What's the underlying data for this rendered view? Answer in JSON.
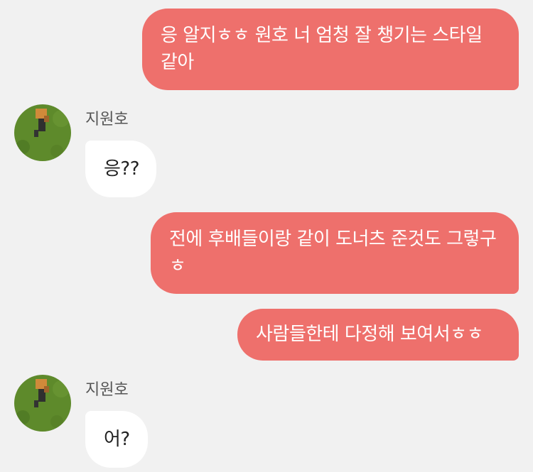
{
  "messages": [
    {
      "side": "out",
      "text": "응 알지ㅎㅎ 원호 너 엄청 잘 챙기는 스타일 같아"
    },
    {
      "side": "in",
      "sender": "지원호",
      "text": "응??"
    },
    {
      "side": "out",
      "text": "전에 후배들이랑 같이 도너츠 준것도 그렇구ㅎ"
    },
    {
      "side": "out",
      "text": "사람들한테 다정해 보여서ㅎㅎ"
    },
    {
      "side": "in",
      "sender": "지원호",
      "text": "어?"
    }
  ],
  "colors": {
    "background": "#f1f1f1",
    "outgoing_bubble": "#ee706c",
    "incoming_bubble": "#ffffff",
    "avatar_grass": "#5e8a2b"
  }
}
